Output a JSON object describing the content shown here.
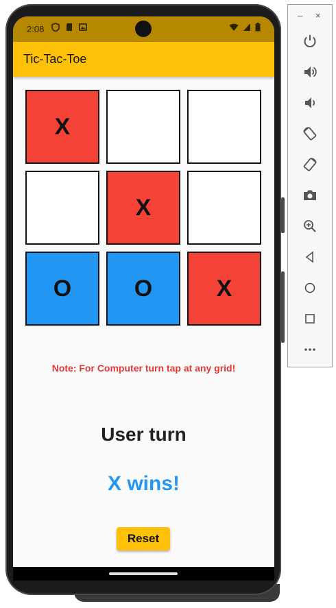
{
  "status_bar": {
    "time": "2:08"
  },
  "app": {
    "title": "Tic-Tac-Toe"
  },
  "board": {
    "cells": [
      {
        "mark": "X",
        "color": "#f44336"
      },
      {
        "mark": "",
        "color": "#ffffff"
      },
      {
        "mark": "",
        "color": "#ffffff"
      },
      {
        "mark": "",
        "color": "#ffffff"
      },
      {
        "mark": "X",
        "color": "#f44336"
      },
      {
        "mark": "",
        "color": "#ffffff"
      },
      {
        "mark": "O",
        "color": "#2196f3"
      },
      {
        "mark": "O",
        "color": "#2196f3"
      },
      {
        "mark": "X",
        "color": "#f44336"
      }
    ]
  },
  "note": "Note: For Computer turn tap at any grid!",
  "turn_text": "User turn",
  "result_text": "X wins!",
  "reset_label": "Reset",
  "emulator": {
    "minimize": "–",
    "close": "×",
    "buttons": [
      "power-icon",
      "volume-up-icon",
      "volume-down-icon",
      "rotate-left-icon",
      "rotate-right-icon",
      "camera-icon",
      "zoom-icon",
      "back-icon",
      "home-icon",
      "overview-icon",
      "more-icon"
    ]
  },
  "colors": {
    "accent": "#ffc107",
    "status_bar": "#b58800",
    "x_cell": "#f44336",
    "o_cell": "#2196f3",
    "note": "#e53935",
    "result": "#2196f3"
  }
}
